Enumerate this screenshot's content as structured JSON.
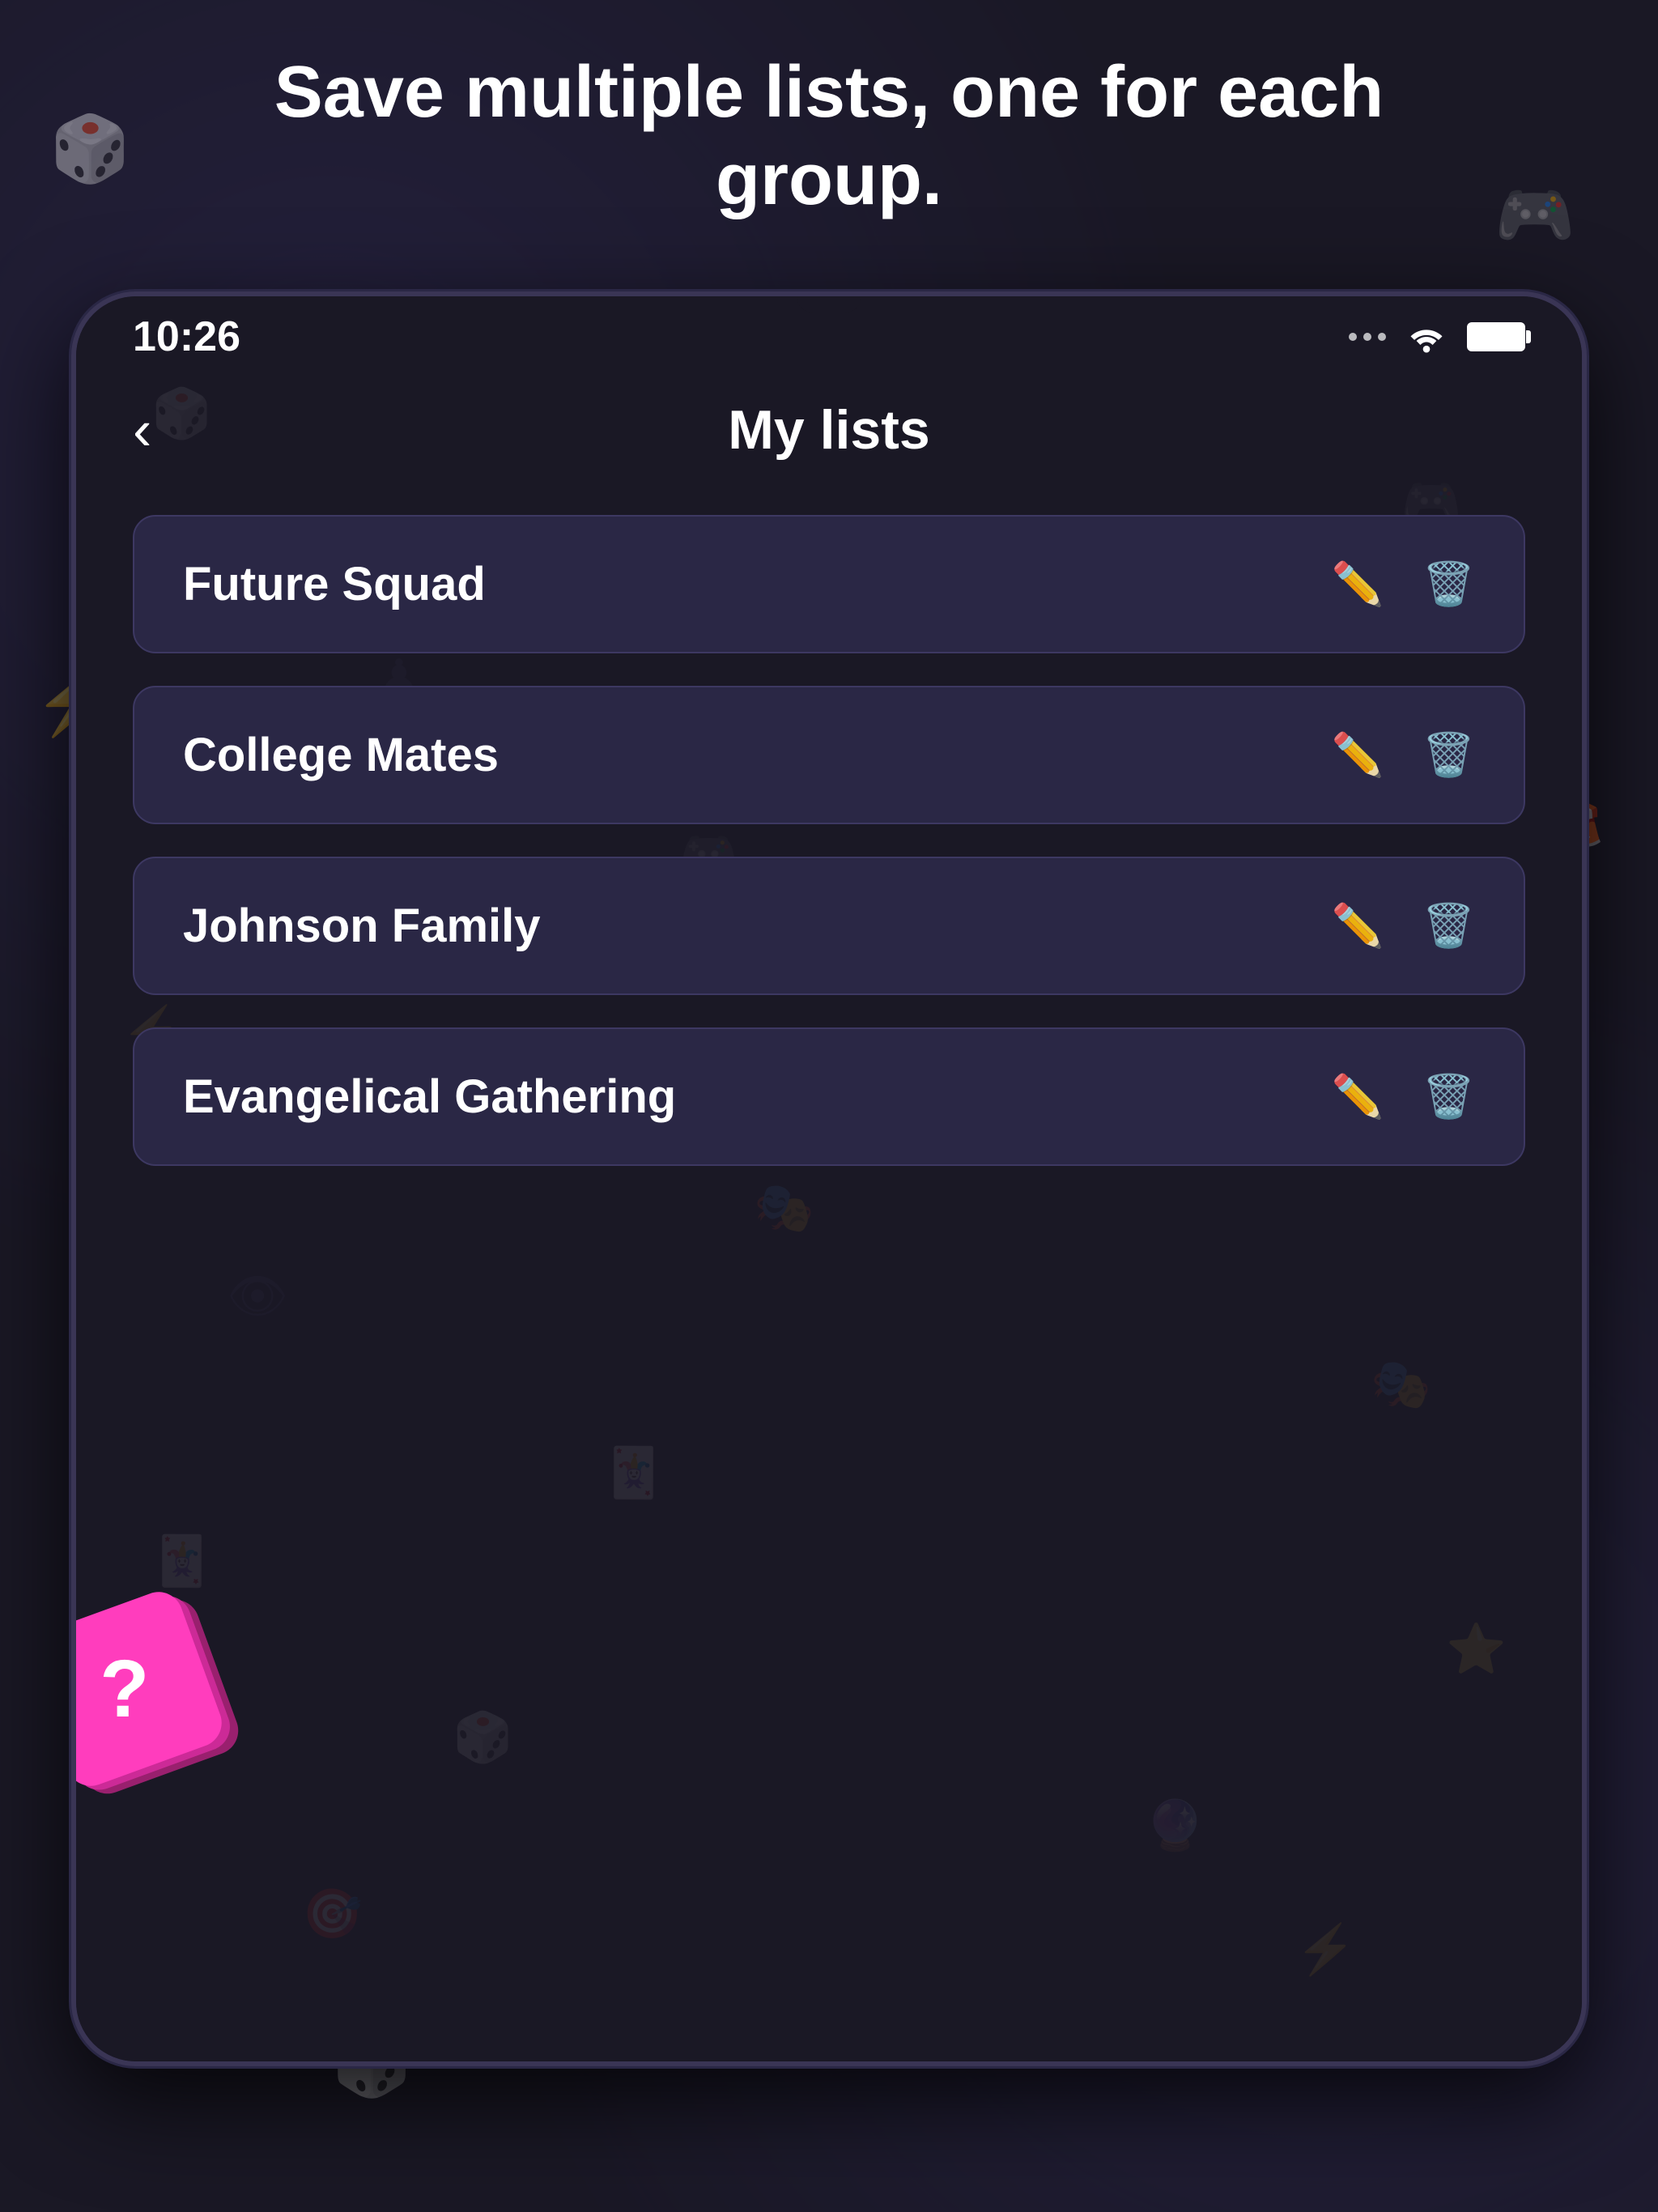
{
  "page": {
    "background_color": "#1a1825",
    "header": {
      "title": "Save multiple lists, one for each group."
    }
  },
  "status_bar": {
    "time": "10:26",
    "signal_label": "signal",
    "wifi_label": "wifi",
    "battery_label": "battery"
  },
  "nav": {
    "back_label": "‹",
    "title": "My lists"
  },
  "lists": [
    {
      "id": "future-squad",
      "name": "Future Squad"
    },
    {
      "id": "college-mates",
      "name": "College Mates"
    },
    {
      "id": "johnson-family",
      "name": "Johnson Family"
    },
    {
      "id": "evangelical-gathering",
      "name": "Evangelical Gathering"
    }
  ],
  "actions": {
    "edit_label": "✏",
    "delete_label": "🗑"
  },
  "dice": {
    "symbol": "?"
  }
}
